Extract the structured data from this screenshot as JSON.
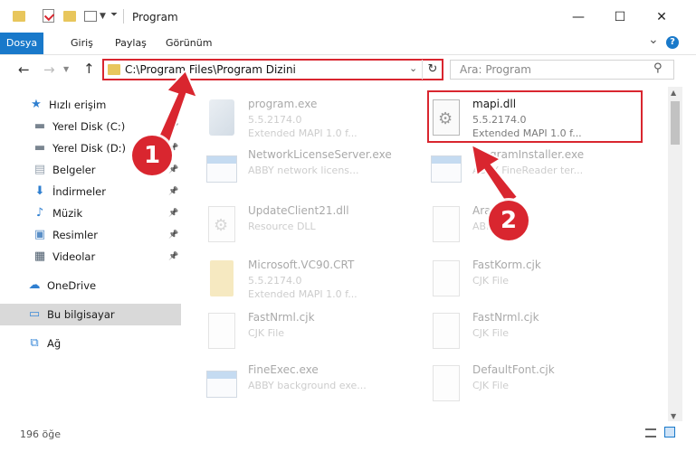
{
  "window": {
    "title": "Program",
    "minimize_glyph": "—",
    "maximize_glyph": "☐",
    "close_glyph": "✕"
  },
  "ribbon": {
    "tabs": [
      "Dosya",
      "Giriş",
      "Paylaş",
      "Görünüm"
    ],
    "accent": "#1979ca",
    "collapse_glyph": "⌄",
    "help_glyph": "?"
  },
  "address": {
    "path": "C:\\Program Files\\Program Dizini",
    "search_placeholder": "Ara: Program"
  },
  "sidebar": {
    "items": [
      {
        "label": "Hızlı erişim",
        "icon": "star-icon",
        "pinned": false
      },
      {
        "label": "Yerel Disk (C:)",
        "icon": "drive-icon",
        "pinned": true
      },
      {
        "label": "Yerel Disk (D:)",
        "icon": "drive-icon",
        "pinned": true
      },
      {
        "label": "Belgeler",
        "icon": "documents-icon",
        "pinned": true
      },
      {
        "label": "İndirmeler",
        "icon": "download-icon",
        "pinned": true
      },
      {
        "label": "Müzik",
        "icon": "music-icon",
        "pinned": true
      },
      {
        "label": "Resimler",
        "icon": "pictures-icon",
        "pinned": true
      },
      {
        "label": "Videolar",
        "icon": "video-icon",
        "pinned": true
      },
      {
        "label": "OneDrive",
        "icon": "cloud-icon",
        "pinned": false
      },
      {
        "label": "Bu bilgisayar",
        "icon": "computer-icon",
        "pinned": false,
        "selected": true
      },
      {
        "label": "Ağ",
        "icon": "network-icon",
        "pinned": false
      }
    ]
  },
  "files": [
    {
      "name": "program.exe",
      "line2": "5.5.2174.0",
      "line3": "Extended MAPI 1.0 f...",
      "icon": "exe-icon",
      "dimmed": true
    },
    {
      "name": "mapi.dll",
      "line2": "5.5.2174.0",
      "line3": "Extended MAPI 1.0 f...",
      "icon": "dll-icon",
      "dimmed": false,
      "highlighted": true
    },
    {
      "name": "NetworkLicenseServer.exe",
      "line2": "ABBY network licens...",
      "line3": "",
      "icon": "window-icon",
      "dimmed": true
    },
    {
      "name": "ProgramInstaller.exe",
      "line2": "ABBY FineReader ter...",
      "line3": "",
      "icon": "window-icon",
      "dimmed": true
    },
    {
      "name": "UpdateClient21.dll",
      "line2": "Resource DLL",
      "line3": "",
      "icon": "dll-icon",
      "dimmed": true
    },
    {
      "name": "Ara...",
      "line2": "ABBY...",
      "line3": "",
      "icon": "doc-icon",
      "dimmed": true
    },
    {
      "name": "Microsoft.VC90.CRT",
      "line2": "5.5.2174.0",
      "line3": "Extended MAPI 1.0 f...",
      "icon": "folder-icon",
      "dimmed": true
    },
    {
      "name": "FastKorm.cjk",
      "line2": "CJK File",
      "line3": "",
      "icon": "doc-icon",
      "dimmed": true
    },
    {
      "name": "FastNrml.cjk",
      "line2": "CJK File",
      "line3": "",
      "icon": "doc-icon",
      "dimmed": true
    },
    {
      "name": "FastNrml.cjk",
      "line2": "CJK File",
      "line3": "",
      "icon": "doc-icon",
      "dimmed": true
    },
    {
      "name": "FineExec.exe",
      "line2": "ABBY background exe...",
      "line3": "",
      "icon": "window-icon",
      "dimmed": true
    },
    {
      "name": "DefaultFont.cjk",
      "line2": "CJK File",
      "line3": "",
      "icon": "doc-icon",
      "dimmed": true
    }
  ],
  "status": {
    "count": "196 öğe"
  },
  "callouts": {
    "one": "1",
    "two": "2",
    "color": "#d9262f"
  }
}
